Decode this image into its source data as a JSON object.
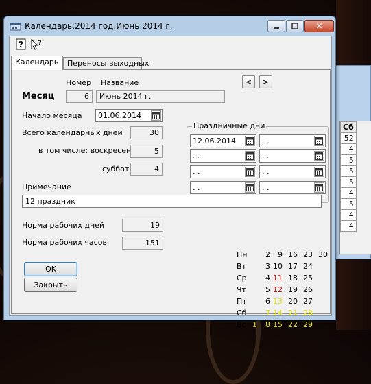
{
  "window": {
    "title": "Календарь:2014 год.Июнь 2014 г.",
    "close_glyph": "✕"
  },
  "toolbar": {
    "help_icon": "help-icon",
    "context_help_icon": "context-help-icon"
  },
  "tabs": [
    "Календарь",
    "Переносы выходных"
  ],
  "month": {
    "header_number": "Номер",
    "header_name": "Название",
    "label": "Месяц",
    "number": "6",
    "name": "Июнь 2014 г.",
    "prev": "<",
    "next": ">"
  },
  "start": {
    "label": "Начало месяца",
    "value": "01.06.2014"
  },
  "total_days": {
    "label": "Всего календарных дней",
    "value": "30"
  },
  "sundays": {
    "label": "в том числе: воскресений",
    "value": "5"
  },
  "saturdays": {
    "label": "суббот",
    "value": "4"
  },
  "holidays": {
    "label": "Праздничные дни",
    "dates": [
      "12.06.2014",
      " .  .",
      " .  .",
      " .  .",
      " .  .",
      " .  .",
      " .  .",
      " .  ."
    ]
  },
  "note": {
    "label": "Примечание",
    "value": "12 праздник"
  },
  "norm_days": {
    "label": "Норма рабочих дней",
    "value": "19"
  },
  "norm_hours": {
    "label": "Норма рабочих часов",
    "value": "151"
  },
  "buttons": {
    "ok": "OK",
    "close": "Закрыть"
  },
  "calendar": {
    "colors": {
      "normal": "#000000",
      "holiday": "#cc0000",
      "weekend": "#e6e600"
    },
    "rows": [
      {
        "day": "Пн",
        "nums": [
          {
            "v": "2",
            "c": "normal"
          },
          {
            "v": "9",
            "c": "normal"
          },
          {
            "v": "16",
            "c": "normal"
          },
          {
            "v": "23",
            "c": "normal"
          },
          {
            "v": "30",
            "c": "normal"
          }
        ]
      },
      {
        "day": "Вт",
        "nums": [
          {
            "v": "3",
            "c": "normal"
          },
          {
            "v": "10",
            "c": "normal"
          },
          {
            "v": "17",
            "c": "normal"
          },
          {
            "v": "24",
            "c": "normal"
          }
        ]
      },
      {
        "day": "Ср",
        "nums": [
          {
            "v": "4",
            "c": "normal"
          },
          {
            "v": "11",
            "c": "holiday"
          },
          {
            "v": "18",
            "c": "normal"
          },
          {
            "v": "25",
            "c": "normal"
          }
        ]
      },
      {
        "day": "Чт",
        "nums": [
          {
            "v": "5",
            "c": "normal"
          },
          {
            "v": "12",
            "c": "holiday"
          },
          {
            "v": "19",
            "c": "normal"
          },
          {
            "v": "26",
            "c": "normal"
          }
        ]
      },
      {
        "day": "Пт",
        "nums": [
          {
            "v": "6",
            "c": "normal"
          },
          {
            "v": "13",
            "c": "weekend"
          },
          {
            "v": "20",
            "c": "normal"
          },
          {
            "v": "27",
            "c": "normal"
          }
        ]
      },
      {
        "day": "Сб",
        "nums": [
          {
            "v": "7",
            "c": "weekend"
          },
          {
            "v": "14",
            "c": "weekend"
          },
          {
            "v": "21",
            "c": "weekend"
          },
          {
            "v": "28",
            "c": "weekend"
          }
        ]
      },
      {
        "day": "Вс",
        "nums": [
          {
            "v": "1",
            "c": "weekend"
          },
          {
            "v": "8",
            "c": "weekend"
          },
          {
            "v": "15",
            "c": "weekend"
          },
          {
            "v": "22",
            "c": "weekend"
          },
          {
            "v": "29",
            "c": "weekend"
          }
        ]
      }
    ]
  },
  "background_window": {
    "header": "Сб",
    "values": [
      "52",
      "4",
      "5",
      "5",
      "5",
      "4",
      "5",
      "4",
      "4"
    ]
  }
}
